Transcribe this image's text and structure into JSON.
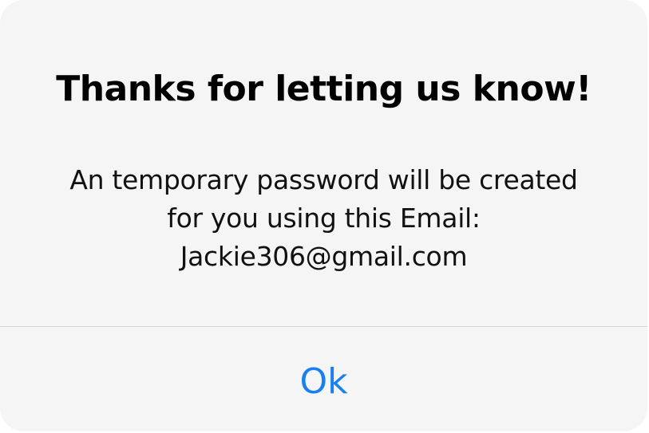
{
  "alert": {
    "title": "Thanks for letting us know!",
    "message_lines": [
      "An temporary password will be created",
      "for you using this Email:",
      "Jackie306@gmail.com"
    ],
    "ok_label": "Ok"
  },
  "colors": {
    "background": "#f5f5f5",
    "title_text": "#000000",
    "message_text": "#111111",
    "divider": "#d9d9d9",
    "button_text": "#1a7ff0"
  }
}
